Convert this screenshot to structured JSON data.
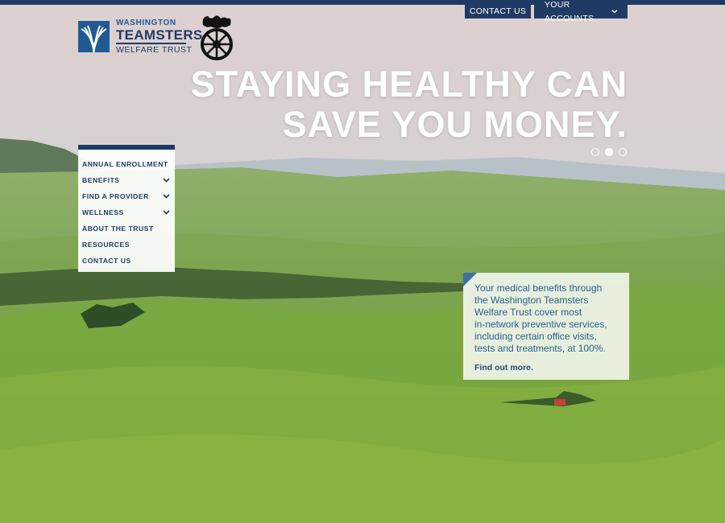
{
  "header": {
    "contact_label": "CONTACT US",
    "accounts_label": "YOUR ACCOUNTS"
  },
  "logo": {
    "line1": "WASHINGTON",
    "line2": "TEAMSTERS",
    "line3": "WELFARE TRUST"
  },
  "hero": {
    "title_line1": "STAYING HEALTHY CAN",
    "title_line2": "SAVE YOU MONEY.",
    "slides": 3,
    "active_slide": 2
  },
  "side_nav": {
    "items": [
      {
        "label": "ANNUAL ENROLLMENT",
        "has_submenu": false
      },
      {
        "label": "BENEFITS",
        "has_submenu": true
      },
      {
        "label": "FIND A PROVIDER",
        "has_submenu": true
      },
      {
        "label": "WELLNESS",
        "has_submenu": true
      },
      {
        "label": "ABOUT THE TRUST",
        "has_submenu": false
      },
      {
        "label": "RESOURCES",
        "has_submenu": false
      },
      {
        "label": "CONTACT US",
        "has_submenu": false
      }
    ]
  },
  "info_card": {
    "line1": "Your medical benefits through",
    "line2": "the Washington Teamsters",
    "line3": "Welfare Trust cover most",
    "line4": "in-network preventive services,",
    "line5": "including certain office visits,",
    "line6": "tests and treatments, at 100%.",
    "link_label": "Find out more."
  },
  "colors": {
    "navy": "#1f3b63",
    "brand_blue": "#1f5a93",
    "card_text": "#2a5d93"
  },
  "icons": {
    "chevron": "chevron-down-icon",
    "emblem": "teamsters-horse-wheel-emblem"
  }
}
